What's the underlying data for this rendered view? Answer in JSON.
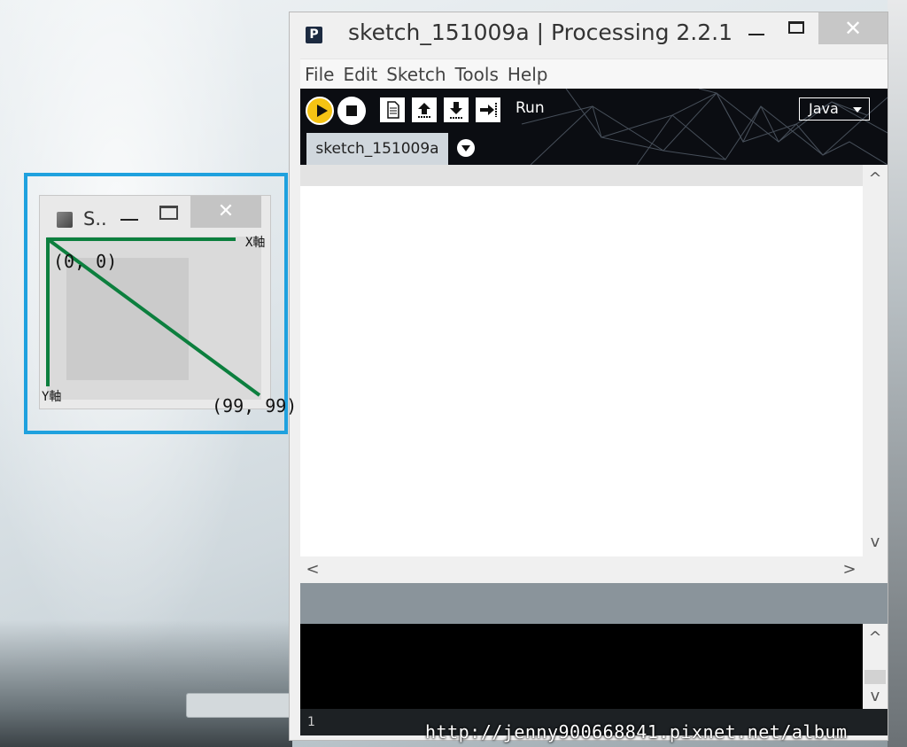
{
  "ide": {
    "window_title": "sketch_151009a | Processing 2.2.1",
    "logo_letter": "P",
    "close_glyph": "✕",
    "menu": [
      "File",
      "Edit",
      "Sketch",
      "Tools",
      "Help"
    ],
    "toolbar": {
      "run_label": "Run",
      "mode": "Java"
    },
    "tab_label": "sketch_151009a",
    "line_number": "1",
    "scroll_up": "^",
    "scroll_down": "v",
    "scroll_left": "<",
    "scroll_right": ">"
  },
  "sketch": {
    "title": "S..",
    "close_glyph": "✕",
    "annotations": {
      "x_axis": "X軸",
      "y_axis": "Y軸",
      "origin": "(0,  0)",
      "end": "(99,  99)"
    },
    "line_color": "#0c7f3e",
    "highlight_color": "#1fa1de"
  },
  "watermark": "http://jenny900668841.pixnet.net/album"
}
